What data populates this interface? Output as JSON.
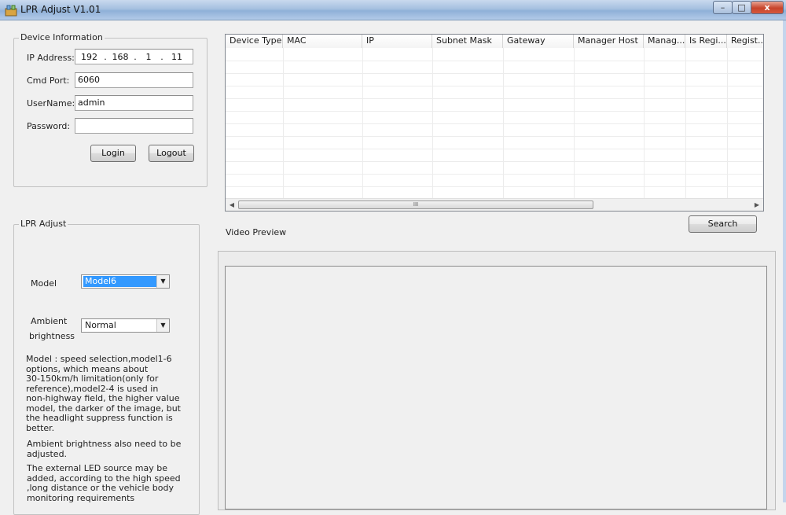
{
  "window": {
    "title": "LPR Adjust V1.01",
    "controls": {
      "minimize": "–",
      "maximize": "□",
      "close": "x"
    }
  },
  "device_info": {
    "legend": "Device Information",
    "ip_label": "IP Address:",
    "ip_parts": [
      "192",
      "168",
      "1",
      "11"
    ],
    "ip_sep": ".",
    "cmd_port_label": "Cmd Port:",
    "cmd_port_value": "6060",
    "username_label": "UserName:",
    "username_value": "admin",
    "password_label": "Password:",
    "password_value": "",
    "login_label": "Login",
    "logout_label": "Logout"
  },
  "lpr_adjust": {
    "legend": "LPR Adjust",
    "model_label": "Model",
    "model_value": "Model6",
    "ambient_label_line1": "Ambient",
    "ambient_label_line2": "brightness",
    "ambient_value": "Normal",
    "desc1": [
      "Model : speed selection,model1-6",
      "options, which means about",
      "30-150km/h limitation(only for",
      "reference),model2-4 is used in",
      "non-highway field, the higher value",
      "model, the darker of the image, but",
      "the headlight suppress function is",
      "better."
    ],
    "desc2": [
      "Ambient brightness also need to be",
      "adjusted."
    ],
    "desc3": [
      "The external LED source may be",
      "added, according to the high speed",
      ",long distance or the vehicle body",
      "monitoring requirements"
    ]
  },
  "device_table": {
    "columns": [
      "Device Type",
      "MAC",
      "IP",
      "Subnet Mask",
      "Gateway",
      "Manager Host",
      "Manag...",
      "Is Regi...",
      "Regist..."
    ],
    "rows": [],
    "scroll_grip": "III"
  },
  "search_label": "Search",
  "video_preview_label": "Video Preview"
}
